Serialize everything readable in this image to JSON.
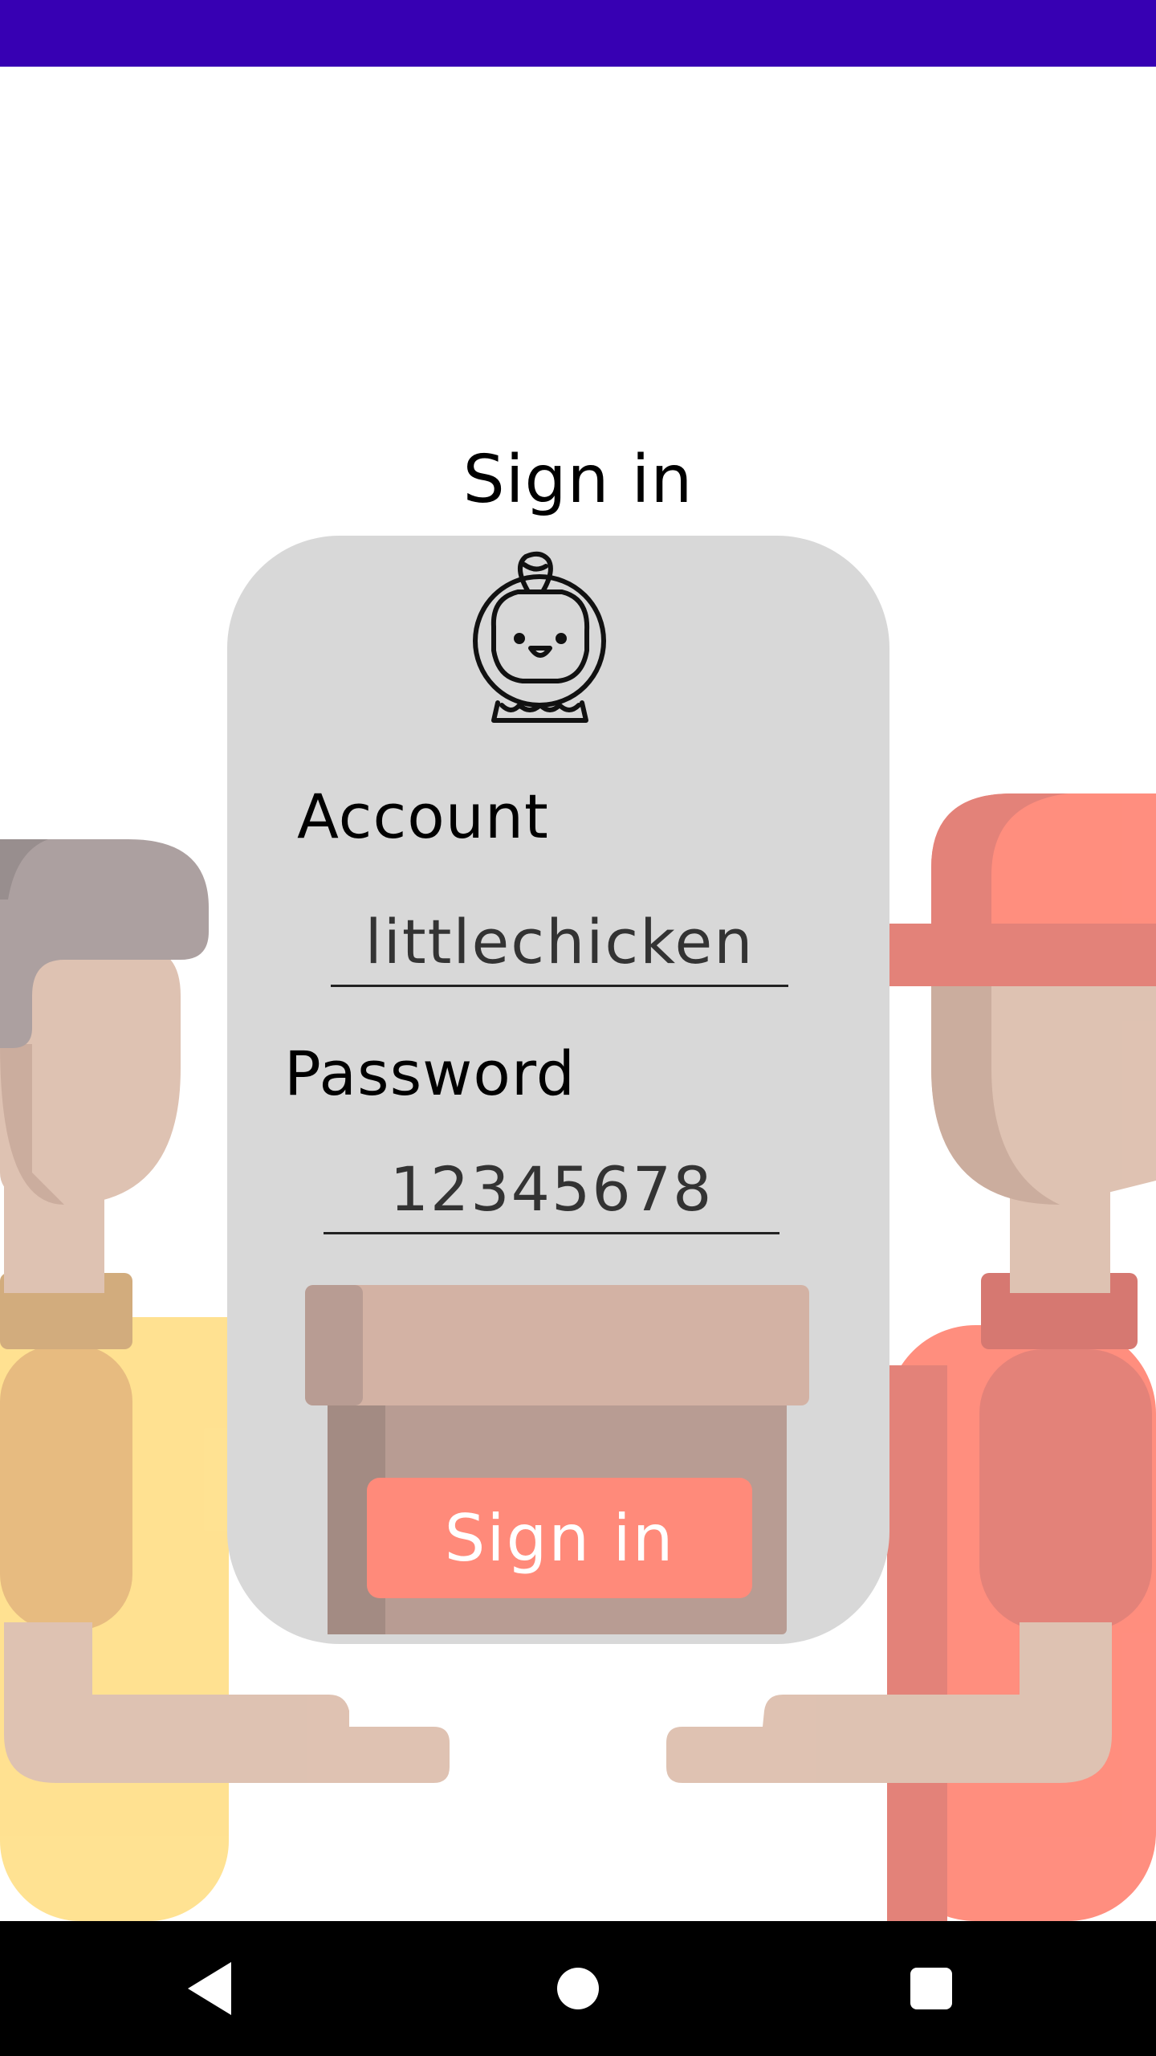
{
  "title": "Sign in",
  "account": {
    "label": "Account",
    "value": "littlechicken"
  },
  "password": {
    "label": "Password",
    "value": "12345678"
  },
  "sign_in_button": "Sign in",
  "colors": {
    "status_bar": "#3700B3",
    "card": "#d8d8d8",
    "button": "#FF8A7A",
    "nav_bar": "#000000"
  },
  "icons": [
    "chicken-mascot-icon",
    "back-icon",
    "home-icon",
    "recents-icon"
  ]
}
